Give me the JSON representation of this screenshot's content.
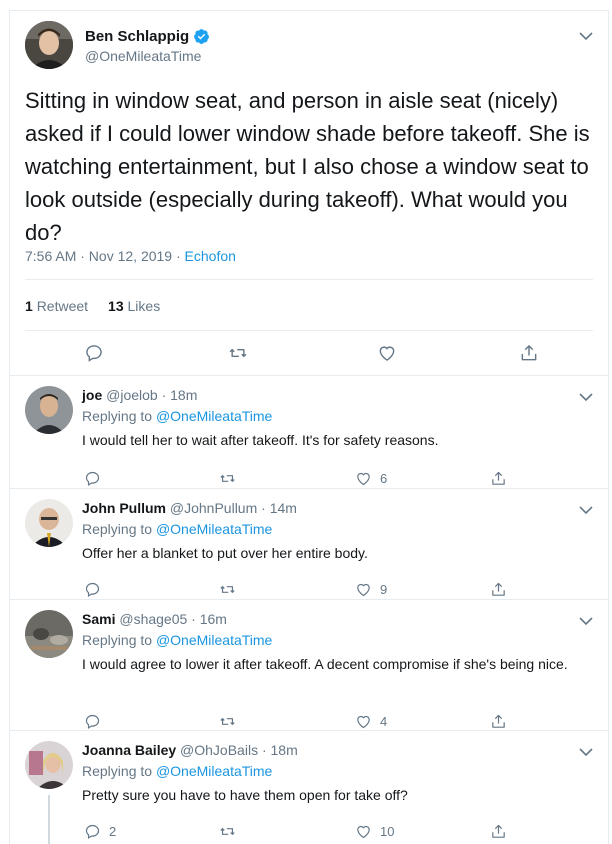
{
  "main_tweet": {
    "author_name": "Ben Schlappig",
    "handle": "@OneMileataTime",
    "text": "Sitting in window seat, and person in aisle seat (nicely) asked if I could lower window shade before takeoff. She is watching entertainment, but I also chose a window seat to look outside (especially during takeoff). What would you do?",
    "time": "7:56 AM · Nov 12, 2019",
    "separator": " · ",
    "source": "Echofon",
    "retweet_count": "1",
    "retweet_label": "Retweet",
    "like_count": "13",
    "like_label": "Likes"
  },
  "replies": [
    {
      "name": "joe",
      "handle": "@joelob · 18m",
      "replying_prefix": "Replying to",
      "replying_to": "@OneMileataTime",
      "text": "I would tell her to wait after takeoff. It's for safety reasons.",
      "reply_count": "",
      "retweet_count": "",
      "like_count": "6"
    },
    {
      "name": "John Pullum",
      "handle": "@JohnPullum · 14m",
      "replying_prefix": "Replying to",
      "replying_to": "@OneMileataTime",
      "text": "Offer her a blanket to put over her entire body.",
      "reply_count": "",
      "retweet_count": "",
      "like_count": "9"
    },
    {
      "name": "Sami",
      "handle": "@shage05 · 16m",
      "replying_prefix": "Replying to",
      "replying_to": "@OneMileataTime",
      "text": "I would agree to lower it after takeoff. A decent compromise if she's being nice.",
      "reply_count": "",
      "retweet_count": "",
      "like_count": "4"
    },
    {
      "name": "Joanna Bailey",
      "handle": "@OhJoBails · 18m",
      "replying_prefix": "Replying to",
      "replying_to": "@OneMileataTime",
      "text": "Pretty sure you have to have them open for take off?",
      "reply_count": "2",
      "retweet_count": "",
      "like_count": "10"
    }
  ],
  "colors": {
    "accent": "#1b95e0",
    "secondary_text": "#657786",
    "border": "#e6ecf0"
  },
  "icons": [
    "verified-badge-icon",
    "caret-down-icon",
    "reply-icon",
    "retweet-icon",
    "like-icon",
    "share-icon"
  ]
}
